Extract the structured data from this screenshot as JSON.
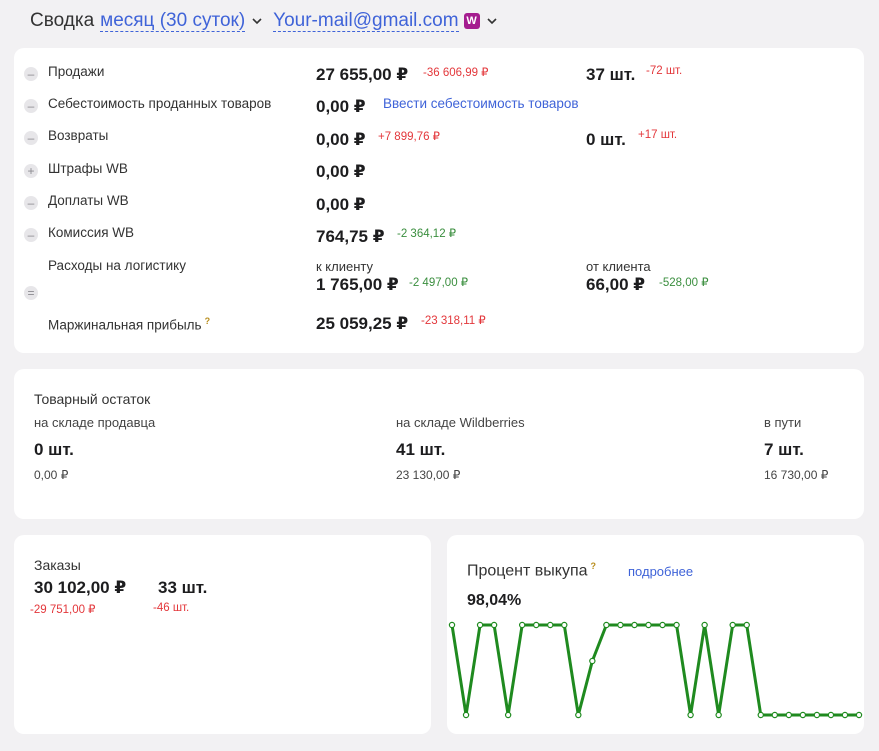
{
  "header": {
    "title": "Сводка",
    "period": "месяц (30 суток)",
    "account": "Your-mail@gmail.com",
    "badge": "W"
  },
  "summary": {
    "sales": {
      "label": "Продажи",
      "value": "27 655,00 ₽",
      "delta": "-36 606,99 ₽",
      "qty": "37 шт.",
      "qty_delta": "-72 шт."
    },
    "cogs": {
      "label": "Себестоимость проданных товаров",
      "value": "0,00 ₽",
      "link": "Ввести себестоимость товаров"
    },
    "returns": {
      "label": "Возвраты",
      "value": "0,00 ₽",
      "delta": "+7 899,76 ₽",
      "qty": "0 шт.",
      "qty_delta": "+17 шт."
    },
    "fines": {
      "label": "Штрафы WB",
      "value": "0,00 ₽"
    },
    "surcharges": {
      "label": "Доплаты WB",
      "value": "0,00 ₽"
    },
    "commission": {
      "label": "Комиссия WB",
      "value": "764,75 ₽",
      "delta": "-2 364,12 ₽"
    },
    "logistics": {
      "label": "Расходы на логистику",
      "to_client_label": "к клиенту",
      "to_client_value": "1 765,00 ₽",
      "to_client_delta": "-2 497,00 ₽",
      "from_client_label": "от клиента",
      "from_client_value": "66,00 ₽",
      "from_client_delta": "-528,00 ₽"
    },
    "margin": {
      "label": "Маржинальная прибыль",
      "hint": "?",
      "value": "25 059,25 ₽",
      "delta": "-23 318,11 ₽"
    }
  },
  "stock": {
    "title": "Товарный остаток",
    "seller": {
      "label": "на складе продавца",
      "qty": "0 шт.",
      "money": "0,00 ₽"
    },
    "wildberries": {
      "label": "на складе Wildberries",
      "qty": "41 шт.",
      "money": "23 130,00 ₽"
    },
    "transit": {
      "label": "в пути",
      "qty": "7 шт.",
      "money": "16 730,00 ₽"
    }
  },
  "orders": {
    "title": "Заказы",
    "amount": "30 102,00 ₽",
    "qty": "33 шт.",
    "amount_delta": "-29 751,00 ₽",
    "qty_delta": "-46 шт."
  },
  "buyout": {
    "title": "Процент выкупа",
    "hint": "?",
    "more": "подробнее",
    "value": "98,04%",
    "line_color": "#1f8a1f"
  },
  "chart_data": {
    "type": "line",
    "x": [
      1,
      2,
      3,
      4,
      5,
      6,
      7,
      8,
      9,
      10,
      11,
      12,
      13,
      14,
      15,
      16,
      17,
      18,
      19,
      20,
      21,
      22,
      23,
      24,
      25,
      26,
      27,
      28,
      29,
      30
    ],
    "values": [
      1,
      0,
      1,
      1,
      0,
      1,
      1,
      1,
      1,
      0,
      0.6,
      1,
      1,
      1,
      1,
      1,
      1,
      0,
      1,
      0,
      1,
      1,
      0,
      0,
      0,
      0,
      0,
      0,
      0,
      0
    ],
    "note_ylim": [
      0,
      1
    ]
  }
}
